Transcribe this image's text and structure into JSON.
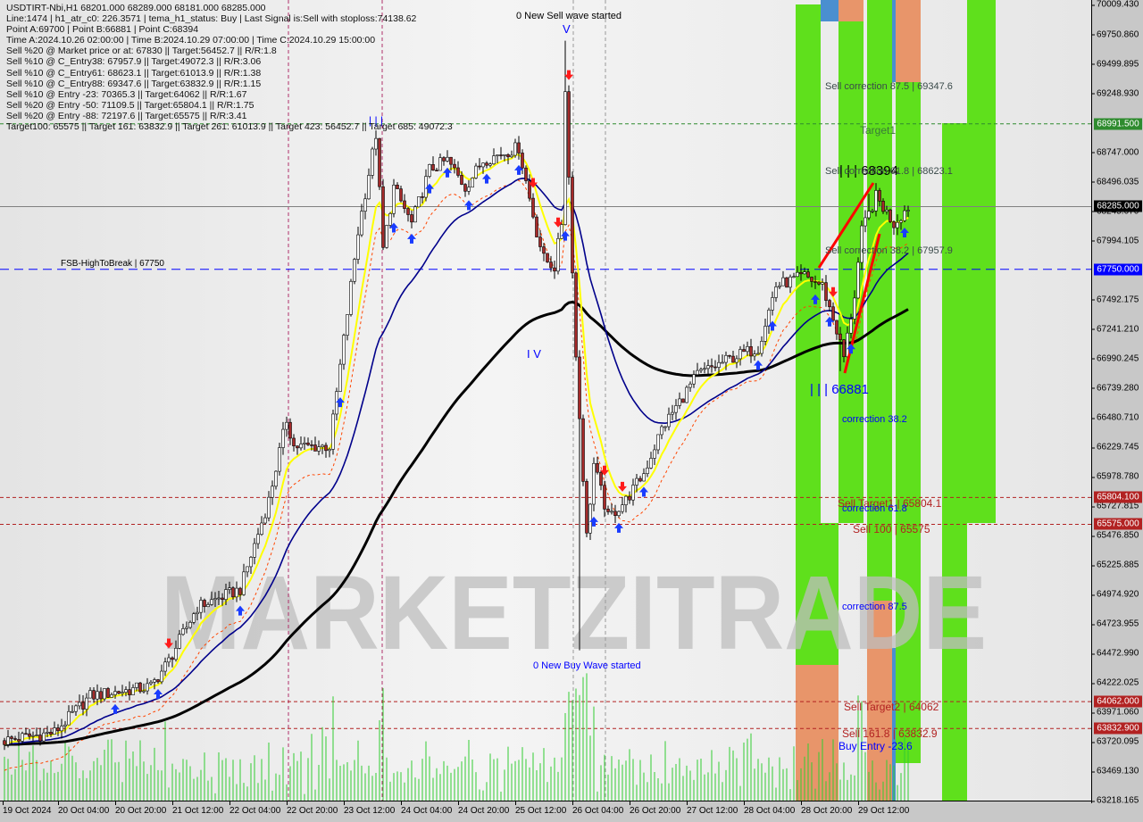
{
  "header": {
    "lines": [
      "USDTIRT-Nbi,H1  68201.000 68289.000 68181.000 68285.000",
      "Line:1474 | h1_atr_c0: 226.3571 | tema_h1_status: Buy | Last Signal is:Sell with stoploss:74138.62",
      "Point A:69700 | Point B:66881 | Point C:68394",
      "Time A:2024.10.26 02:00:00 | Time B:2024.10.29 07:00:00 | Time C:2024.10.29 15:00:00",
      "Sell %20 @ Market price or at: 67830 || Target:56452.7 || R/R:1.8",
      "Sell %10 @ C_Entry38: 67957.9 || Target:49072.3 || R/R:3.06",
      "Sell %10 @ C_Entry61: 68623.1 || Target:61013.9 || R/R:1.38",
      "Sell %10 @ C_Entry88: 69347.6 || Target:63832.9 || R/R:1.15",
      "Sell %10 @ Entry -23: 70365.3 || Target:64062 || R/R:1.67",
      "Sell %20 @ Entry -50: 71109.5 || Target:65804.1 || R/R:1.75",
      "Sell %20 @ Entry -88: 72197.6 || Target:65575 || R/R:3.41",
      "Target100: 65575 || Target 161: 63832.9 || Target 261: 61013.9 || Target 423: 56452.7 || Target 685: 49072.3"
    ]
  },
  "annotations": {
    "sell_wave": "0 New Sell wave started",
    "sell_wave_mark": "V",
    "buy_wave": "0 New Buy Wave started",
    "wave_iv": "I V",
    "point_b": "| | | 66881",
    "point_c": "| | | 68394",
    "top_marks": "| | |",
    "fsb": "FSB-HighToBreak | 67750",
    "sell_corr_875": "Sell correction 87.5 | 69347.6",
    "target1": "Target1",
    "sell_corr_618": "Sell correction 61.8 | 68623.1",
    "sell_corr_382": "Sell correction 38.2 | 67957.9",
    "corr_382": "correction 38.2",
    "sell_target1": "Sell Target1 | 65804.1",
    "corr_618": "correction 61.8",
    "sell_100": "Sell 100 | 65575",
    "corr_875": "correction 87.5",
    "sell_target2": "Sell Target2 | 64062",
    "sell_1618": "Sell 161.8 | 63832.9",
    "buy_entry": "Buy Entry -23.6",
    "watermark": "MARKETZITRADE"
  },
  "chart_data": {
    "type": "candlestick",
    "symbol": "USDTIRT-Nbi",
    "timeframe": "H1",
    "ylim": [
      63218.165,
      70009.43
    ],
    "y_ticks": [
      "70009.430",
      "69750.860",
      "69499.895",
      "69248.930",
      "68747.000",
      "68496.035",
      "68245.070",
      "67994.105",
      "67492.175",
      "67241.210",
      "66990.245",
      "66739.280",
      "66480.710",
      "66229.745",
      "65978.780",
      "65727.815",
      "65476.850",
      "65225.885",
      "64974.920",
      "64723.955",
      "64472.990",
      "64222.025",
      "63971.060",
      "63720.095",
      "63469.130",
      "63218.165"
    ],
    "price_badges": [
      {
        "value": "68991.500",
        "color": "#2e8b2e"
      },
      {
        "value": "68285.000",
        "color": "#000000"
      },
      {
        "value": "67750.000",
        "color": "#0000ff"
      },
      {
        "value": "65804.100",
        "color": "#b22222"
      },
      {
        "value": "65575.000",
        "color": "#b22222"
      },
      {
        "value": "64062.000",
        "color": "#b22222"
      },
      {
        "value": "63832.900",
        "color": "#b22222"
      }
    ],
    "x_ticks": [
      "19 Oct 2024",
      "20 Oct 04:00",
      "20 Oct 20:00",
      "21 Oct 12:00",
      "22 Oct 04:00",
      "22 Oct 20:00",
      "23 Oct 12:00",
      "24 Oct 04:00",
      "24 Oct 20:00",
      "25 Oct 12:00",
      "26 Oct 04:00",
      "26 Oct 20:00",
      "27 Oct 12:00",
      "28 Oct 04:00",
      "28 Oct 20:00",
      "29 Oct 12:00"
    ],
    "hlines": [
      {
        "price": 68991.5,
        "color": "#2e8b2e",
        "style": "dashed"
      },
      {
        "price": 68285,
        "color": "#808080",
        "style": "solid"
      },
      {
        "price": 67750,
        "color": "#0000ff",
        "style": "dashed"
      },
      {
        "price": 65804.1,
        "color": "#b22222",
        "style": "dashed"
      },
      {
        "price": 65575,
        "color": "#b22222",
        "style": "dashed"
      },
      {
        "price": 64062,
        "color": "#b22222",
        "style": "dashed"
      },
      {
        "price": 63832.9,
        "color": "#b22222",
        "style": "dashed"
      }
    ],
    "close_path": [
      [
        "2024-10-19 13:00",
        63730
      ],
      [
        "2024-10-20 03:00",
        63800
      ],
      [
        "2024-10-20 13:00",
        64110
      ],
      [
        "2024-10-21 06:00",
        64190
      ],
      [
        "2024-10-21 11:00",
        64410
      ],
      [
        "2024-10-21 19:00",
        64870
      ],
      [
        "2024-10-22 07:00",
        65020
      ],
      [
        "2024-10-22 15:00",
        65780
      ],
      [
        "2024-10-22 20:00",
        66470
      ],
      [
        "2024-10-22 22:00",
        66240
      ],
      [
        "2024-10-23 08:00",
        66240
      ],
      [
        "2024-10-23 12:00",
        67150
      ],
      [
        "2024-10-23 16:00",
        68070
      ],
      [
        "2024-10-23 21:00",
        68900
      ],
      [
        "2024-10-23 23:00",
        67920
      ],
      [
        "2024-10-24 02:00",
        68450
      ],
      [
        "2024-10-24 07:00",
        68140
      ],
      [
        "2024-10-24 12:00",
        68600
      ],
      [
        "2024-10-24 17:00",
        68680
      ],
      [
        "2024-10-24 22:00",
        68450
      ],
      [
        "2024-10-25 03:00",
        68680
      ],
      [
        "2024-10-25 13:00",
        68790
      ],
      [
        "2024-10-25 18:00",
        68070
      ],
      [
        "2024-10-25 20:00",
        67840
      ],
      [
        "2024-10-25 23:00",
        67770
      ],
      [
        "2024-10-26 01:00",
        68150
      ],
      [
        "2024-10-26 02:00",
        69300
      ],
      [
        "2024-10-26 05:00",
        67000
      ],
      [
        "2024-10-26 08:00",
        65470
      ],
      [
        "2024-10-26 10:00",
        66090
      ],
      [
        "2024-10-26 14:00",
        65630
      ],
      [
        "2024-10-26 19:00",
        65780
      ],
      [
        "2024-10-27 00:00",
        66010
      ],
      [
        "2024-10-27 05:00",
        66390
      ],
      [
        "2024-10-27 10:00",
        66620
      ],
      [
        "2024-10-27 15:00",
        66850
      ],
      [
        "2024-10-28 01:00",
        67000
      ],
      [
        "2024-10-28 08:00",
        67080
      ],
      [
        "2024-10-28 13:00",
        67610
      ],
      [
        "2024-10-28 21:00",
        67690
      ],
      [
        "2024-10-29 02:00",
        67610
      ],
      [
        "2024-10-29 06:00",
        67230
      ],
      [
        "2024-10-29 08:00",
        67000
      ],
      [
        "2024-10-29 11:00",
        67530
      ],
      [
        "2024-10-29 13:00",
        68070
      ],
      [
        "2024-10-29 17:00",
        68370
      ],
      [
        "2024-10-29 22:00",
        68140
      ],
      [
        "2024-10-30 02:00",
        68285
      ]
    ],
    "extremes": [
      {
        "time": "2024-10-26 02:00",
        "high": 69700
      },
      {
        "time": "2024-10-26 06:00",
        "low": 64500
      },
      {
        "time": "2024-10-29 07:00",
        "low": 66881
      },
      {
        "time": "2024-10-29 15:00",
        "high": 68394
      }
    ],
    "buy_signals": [
      "2024-10-20 20:00",
      "2024-10-21 08:00",
      "2024-10-22 07:00",
      "2024-10-23 11:00",
      "2024-10-24 02:00",
      "2024-10-24 07:00",
      "2024-10-24 12:00",
      "2024-10-24 17:00",
      "2024-10-24 23:00",
      "2024-10-25 04:00",
      "2024-10-25 13:00",
      "2024-10-26 02:00",
      "2024-10-26 10:00",
      "2024-10-26 17:00",
      "2024-10-27 00:00",
      "2024-10-28 08:00",
      "2024-10-28 12:00",
      "2024-10-29 00:00",
      "2024-10-29 04:00",
      "2024-10-29 10:00",
      "2024-10-30 01:00"
    ],
    "sell_signals": [
      "2024-10-21 11:00",
      "2024-10-25 17:00",
      "2024-10-26 00:00",
      "2024-10-26 03:00",
      "2024-10-26 13:00",
      "2024-10-26 18:00",
      "2024-10-29 05:00"
    ],
    "colors": {
      "bull": "#ffffff",
      "bear": "#a52a2a",
      "fast_ma": "#ffff00",
      "mid_ma": "#00008b",
      "slow_ma": "#000000",
      "volume": "#32cd32",
      "zone_green": "#5fe01c",
      "zone_orange": "#e8956a",
      "zone_blue": "#4a8fd0"
    }
  }
}
